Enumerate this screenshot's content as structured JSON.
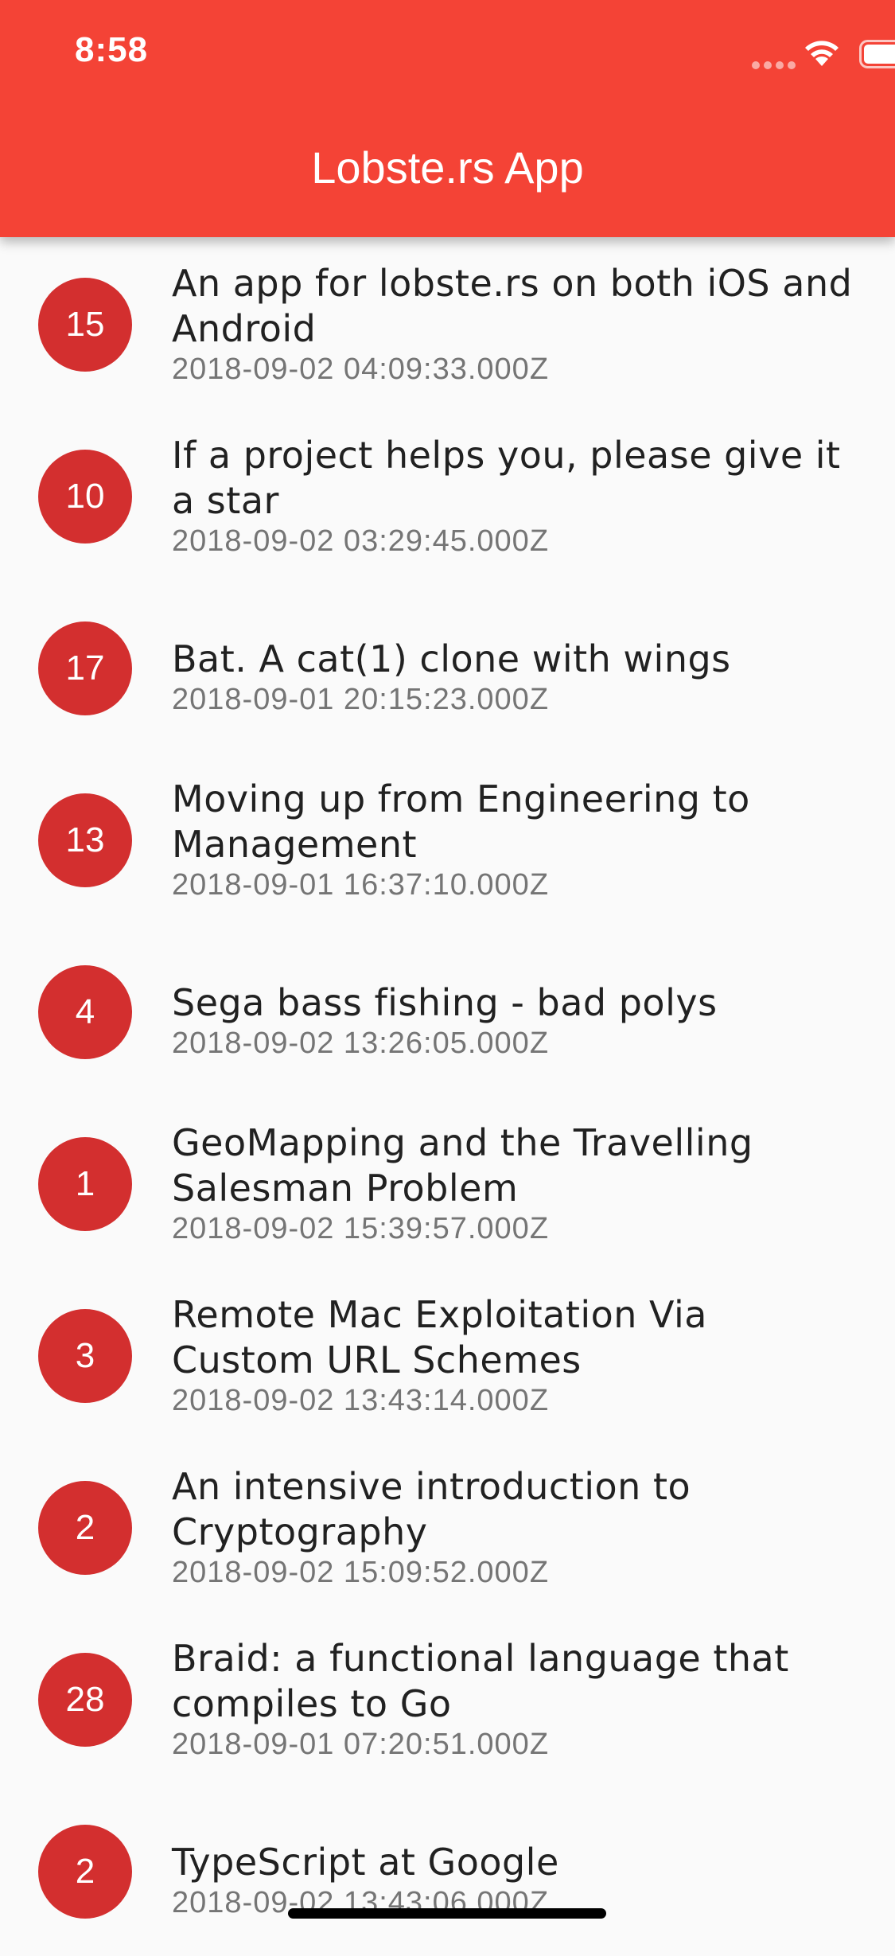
{
  "status_bar": {
    "time": "8:58"
  },
  "app_bar": {
    "title": "Lobste.rs App"
  },
  "stories": [
    {
      "score": "15",
      "title": "An app for lobste.rs on both iOS and Android",
      "date": "2018-09-02 04:09:33.000Z"
    },
    {
      "score": "10",
      "title": "If a project helps you, please give it a star",
      "date": "2018-09-02 03:29:45.000Z"
    },
    {
      "score": "17",
      "title": "Bat. A cat(1) clone with wings",
      "date": "2018-09-01 20:15:23.000Z"
    },
    {
      "score": "13",
      "title": "Moving up from Engineering to Management",
      "date": "2018-09-01 16:37:10.000Z"
    },
    {
      "score": "4",
      "title": "Sega bass fishing - bad polys",
      "date": "2018-09-02 13:26:05.000Z"
    },
    {
      "score": "1",
      "title": "GeoMapping and the Travelling Salesman Problem",
      "date": "2018-09-02 15:39:57.000Z"
    },
    {
      "score": "3",
      "title": "Remote Mac Exploitation Via Custom URL Schemes",
      "date": "2018-09-02 13:43:14.000Z"
    },
    {
      "score": "2",
      "title": "An intensive introduction to Cryptography",
      "date": "2018-09-02 15:09:52.000Z"
    },
    {
      "score": "28",
      "title": "Braid: a functional language that compiles to Go",
      "date": "2018-09-01 07:20:51.000Z"
    },
    {
      "score": "2",
      "title": "TypeScript at Google",
      "date": "2018-09-02 13:43:06.000Z"
    }
  ],
  "colors": {
    "app_bar": "#f44336",
    "avatar": "#d32f2f",
    "background": "#fafafa"
  }
}
